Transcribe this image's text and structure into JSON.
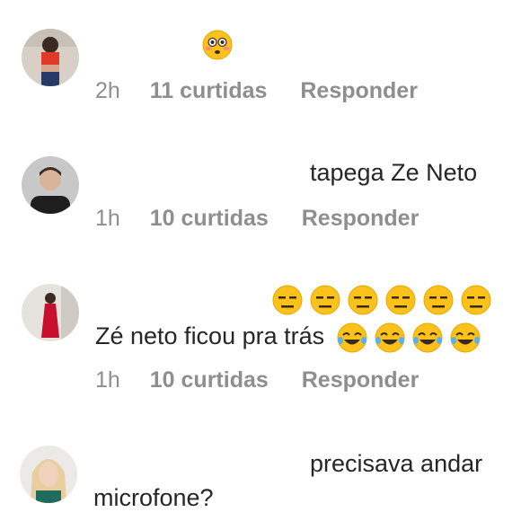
{
  "comments": [
    {
      "avatar": "avatar-woman-red-top",
      "text": "",
      "emoji": [
        "flushed-face-emoji"
      ],
      "time": "2h",
      "likes": "11 curtidas",
      "reply": "Responder"
    },
    {
      "avatar": "avatar-young-man",
      "text": "tapega Ze Neto",
      "time": "1h",
      "likes": "10 curtidas",
      "reply": "Responder"
    },
    {
      "avatar": "avatar-woman-red-dress",
      "emoji_row": [
        "expressionless-face-emoji",
        "expressionless-face-emoji",
        "expressionless-face-emoji",
        "expressionless-face-emoji",
        "expressionless-face-emoji",
        "expressionless-face-emoji"
      ],
      "text": "Zé neto ficou pra trás",
      "trailing_emoji": [
        "laughing-tears-emoji",
        "laughing-tears-emoji",
        "laughing-tears-emoji",
        "laughing-tears-emoji"
      ],
      "time": "1h",
      "likes": "10 curtidas",
      "reply": "Responder"
    },
    {
      "avatar": "avatar-woman-blonde",
      "text_line1": "precisava andar",
      "text_line2": "microfone?"
    }
  ]
}
